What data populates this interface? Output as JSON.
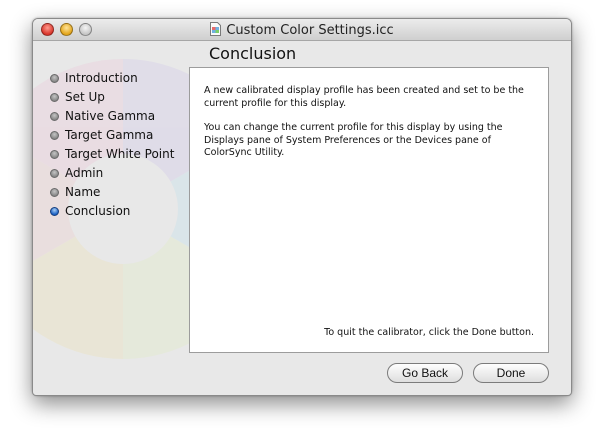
{
  "window": {
    "title": "Custom Color Settings.icc"
  },
  "page": {
    "heading": "Conclusion"
  },
  "steps": [
    {
      "label": "Introduction",
      "active": false
    },
    {
      "label": "Set Up",
      "active": false
    },
    {
      "label": "Native Gamma",
      "active": false
    },
    {
      "label": "Target Gamma",
      "active": false
    },
    {
      "label": "Target White Point",
      "active": false
    },
    {
      "label": "Admin",
      "active": false
    },
    {
      "label": "Name",
      "active": false
    },
    {
      "label": "Conclusion",
      "active": true
    }
  ],
  "content": {
    "paragraph1": "A new calibrated display profile has been created and set to be the current profile for this display.",
    "paragraph2": "You can change the current profile for this display by using the Displays pane of System Preferences or the Devices pane of ColorSync Utility.",
    "quit_note": "To quit the calibrator, click the Done button."
  },
  "buttons": {
    "back": "Go Back",
    "done": "Done"
  },
  "colors": {
    "active_step": "#1a5fc2",
    "close": "#d9352b",
    "minimize": "#e3a51b"
  }
}
